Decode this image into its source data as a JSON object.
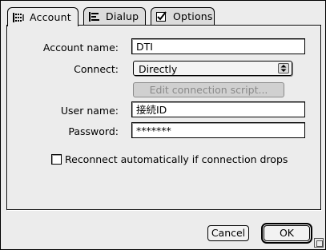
{
  "tabs": [
    {
      "label": "Account",
      "icon": "grid-icon",
      "active": true
    },
    {
      "label": "Dialup",
      "icon": "bars-icon",
      "active": false
    },
    {
      "label": "Options",
      "icon": "checkbox-icon",
      "active": false
    }
  ],
  "form": {
    "account_name_label": "Account name:",
    "account_name_value": "DTI",
    "connect_label": "Connect:",
    "connect_value": "Directly",
    "edit_script_label": "Edit connection script...",
    "user_name_label": "User name:",
    "user_name_value": "接続ID",
    "password_label": "Password:",
    "password_value": "*******",
    "reconnect_label": "Reconnect automatically if connection drops",
    "reconnect_checked": false
  },
  "buttons": {
    "cancel": "Cancel",
    "ok": "OK"
  }
}
